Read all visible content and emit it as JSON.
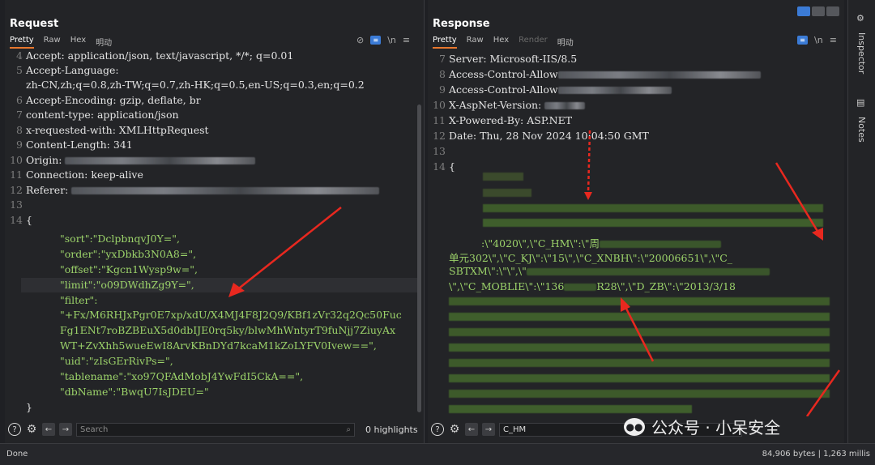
{
  "request": {
    "title": "Request",
    "tabs": [
      "Pretty",
      "Raw",
      "Hex",
      "明动"
    ],
    "lines": [
      {
        "n": "4",
        "text": "Accept: application/json, text/javascript, */*; q=0.01"
      },
      {
        "n": "5",
        "text": "Accept-Language:"
      },
      {
        "n": "",
        "text": "zh-CN,zh;q=0.8,zh-TW;q=0.7,zh-HK;q=0.5,en-US;q=0.3,en;q=0.2"
      },
      {
        "n": "6",
        "text": "Accept-Encoding: gzip, deflate, br"
      },
      {
        "n": "7",
        "text": "content-type: application/json"
      },
      {
        "n": "8",
        "text": "x-requested-with: XMLHttpRequest"
      },
      {
        "n": "9",
        "text": "Content-Length: 341"
      },
      {
        "n": "10",
        "text": "Origin: "
      },
      {
        "n": "11",
        "text": "Connection: keep-alive"
      },
      {
        "n": "12",
        "text": "Referer: "
      },
      {
        "n": "13",
        "text": ""
      },
      {
        "n": "14",
        "text": "{"
      }
    ],
    "json_lines": [
      "\"sort\":\"DclpbnqvJ0Y=\",",
      "\"order\":\"yxDbkb3N0A8=\",",
      "\"offset\":\"Kgcn1Wysp9w=\",",
      "\"limit\":\"o09DWdhZg9Y=\",",
      "\"filter\":",
      "\"+Fx/M6RHJxPgr0E7xp/xdU/X4MJ4F8J2Q9/KBf1zVr32q2Qc50Fuc",
      "Fg1ENt7roBZBEuX5d0dbIJE0rq5ky/blwMhWntyrT9fuNjj7ZiuyAx",
      "WT+ZvXhh5wueEwI8ArvKBnDYd7kcaM1kZoLYFV0Ivew==\",",
      "\"uid\":\"zIsGErRivPs=\",",
      "\"tablename\":\"xo97QFAdMobJ4YwFdI5CkA==\",",
      "\"dbName\":\"BwqU7IsJDEU=\""
    ],
    "closing": "}",
    "search_placeholder": "Search",
    "highlights": "0 highlights"
  },
  "response": {
    "title": "Response",
    "tabs": [
      "Pretty",
      "Raw",
      "Hex",
      "Render",
      "明动"
    ],
    "lines": [
      {
        "n": "7",
        "text": "Server: Microsoft-IIS/8.5"
      },
      {
        "n": "8",
        "text": "Access-Control-Allow"
      },
      {
        "n": "9",
        "text": "Access-Control-Allow"
      },
      {
        "n": "10",
        "text": "X-AspNet-Version: "
      },
      {
        "n": "11",
        "text": "X-Powered-By: ASP.NET"
      },
      {
        "n": "12",
        "text": "Date: Thu, 28 Nov 2024 10:04:50 GMT"
      },
      {
        "n": "13",
        "text": ""
      },
      {
        "n": "14",
        "text": "{"
      }
    ],
    "body_lines": [
      ":\\\"4020\\\",\\\"C_HM\\\":\\\"周",
      "单元302\\\",\\\"C_KJ\\\":\\\"15\\\",\\\"C_XNBH\\\":\\\"20006651\\\",\\\"C_",
      "SBTXM\\\":\\\"\\\",\\\"",
      "\\\",\\\"C_MOBLIE\\\":\\\"136",
      "R28\\\",\\\"D_ZB\\\":\\\"2013/3/18"
    ],
    "search_value": "C_HM"
  },
  "inspector": {
    "label": "Inspector",
    "notes": "Notes"
  },
  "watermark": "公众号 · 小呆安全",
  "status": {
    "left": "Done",
    "right": "84,906 bytes | 1,263 millis"
  }
}
